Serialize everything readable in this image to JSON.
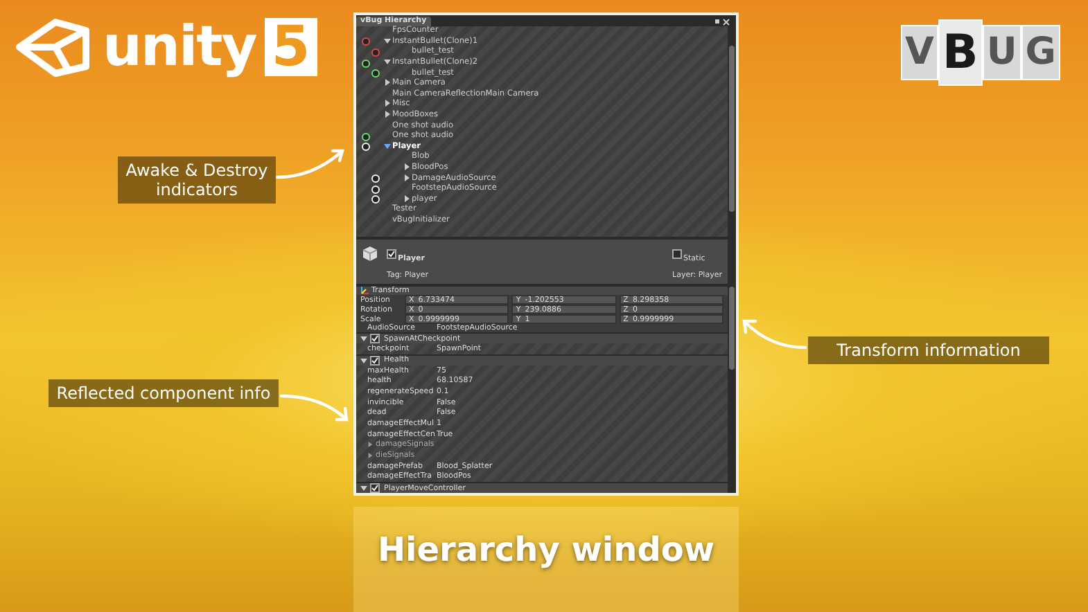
{
  "unity_logo": {
    "word": "unity",
    "version": "5"
  },
  "vbug_logo": {
    "letters": [
      "V",
      "B",
      "U",
      "G"
    ]
  },
  "window": {
    "tab": "vBug Hierarchy",
    "hierarchy": [
      {
        "label": "FpsCounter",
        "selected": false
      },
      {
        "label": "InstantBullet(Clone)1",
        "selected": false,
        "color": "#e04848",
        "expanded": true,
        "children": [
          {
            "label": "bullet_test",
            "selected": false,
            "color": "#e04848"
          }
        ]
      },
      {
        "label": "InstantBullet(Clone)2",
        "selected": false,
        "color": "#6ede6e",
        "expanded": true,
        "children": [
          {
            "label": "bullet_test",
            "selected": false,
            "color": "#6ede6e"
          }
        ]
      },
      {
        "label": "Main Camera",
        "selected": false,
        "expanded": false
      },
      {
        "label": "Main CameraReflectionMain Camera",
        "selected": false
      },
      {
        "label": "Misc",
        "selected": false,
        "expanded": false
      },
      {
        "label": "MoodBoxes",
        "selected": false,
        "expanded": false
      },
      {
        "label": "One shot audio",
        "selected": false
      },
      {
        "label": "One shot audio",
        "selected": false,
        "color": "#6ede6e"
      },
      {
        "label": "Player",
        "selected": true,
        "color": "#f0f0f0",
        "expanded": true,
        "children": [
          {
            "label": "Blob",
            "selected": false
          },
          {
            "label": "BloodPos",
            "selected": false,
            "expanded": false
          },
          {
            "label": "DamageAudioSource",
            "selected": false,
            "color": "#f0f0f0",
            "expanded": false
          },
          {
            "label": "FootstepAudioSource",
            "selected": false,
            "color": "#f0f0f0"
          },
          {
            "label": "player",
            "selected": false,
            "color": "#f0f0f0",
            "expanded": false
          }
        ]
      },
      {
        "label": "Tester",
        "selected": false
      },
      {
        "label": "vBugInitializer",
        "selected": false
      }
    ],
    "inspector": {
      "name": "Player",
      "active": true,
      "static_label": "Static",
      "static": false,
      "tag": "Tag: Player",
      "layer": "Layer: Player",
      "transform": {
        "title": "Transform",
        "rows": [
          {
            "label": "Position",
            "values": [
              {
                "axis": "X",
                "value": "6.733474"
              },
              {
                "axis": "Y",
                "value": "-1.202553"
              },
              {
                "axis": "Z",
                "value": "8.298358"
              }
            ]
          },
          {
            "label": "Rotation",
            "values": [
              {
                "axis": "X",
                "value": "0"
              },
              {
                "axis": "Y",
                "value": "239.0886"
              },
              {
                "axis": "Z",
                "value": "0"
              }
            ]
          },
          {
            "label": "Scale",
            "values": [
              {
                "axis": "X",
                "value": "0.9999999"
              },
              {
                "axis": "Y",
                "value": "1"
              },
              {
                "axis": "Z",
                "value": "0.9999999"
              }
            ]
          }
        ]
      },
      "cut_row": {
        "label": "AudioSource",
        "value": "FootstepAudioSource"
      },
      "components": [
        {
          "name": "SpawnAtCheckpoint",
          "expanded": true,
          "enabled": true,
          "fields": [
            {
              "kind": "value",
              "label": "checkpoint",
              "value": "SpawnPoint"
            }
          ]
        },
        {
          "name": "Health",
          "expanded": true,
          "enabled": true,
          "fields": [
            {
              "kind": "value",
              "label": "maxHealth",
              "value": "75"
            },
            {
              "kind": "value",
              "label": "health",
              "value": "68.10587"
            },
            {
              "kind": "value",
              "label": "regenerateSpeed",
              "value": "0.1"
            },
            {
              "kind": "value",
              "label": "invincible",
              "value": "False"
            },
            {
              "kind": "value",
              "label": "dead",
              "value": "False"
            },
            {
              "kind": "value",
              "label": "damageEffectMul",
              "value": "1"
            },
            {
              "kind": "value",
              "label": "damageEffectCen",
              "value": "True"
            },
            {
              "kind": "foldout",
              "label": "damageSignals"
            },
            {
              "kind": "foldout",
              "label": "dieSignals"
            },
            {
              "kind": "value",
              "label": "damagePrefab",
              "value": "Blood_Splatter"
            },
            {
              "kind": "value",
              "label": "damageEffectTra",
              "value": "BloodPos"
            }
          ]
        },
        {
          "name": "PlayerMoveController",
          "expanded": true,
          "enabled": true
        }
      ]
    }
  },
  "callouts": [
    {
      "text": "Awake & Destroy indicators"
    },
    {
      "text": "Reflected component info"
    },
    {
      "text": "Transform information"
    }
  ],
  "caption": "Hierarchy window"
}
